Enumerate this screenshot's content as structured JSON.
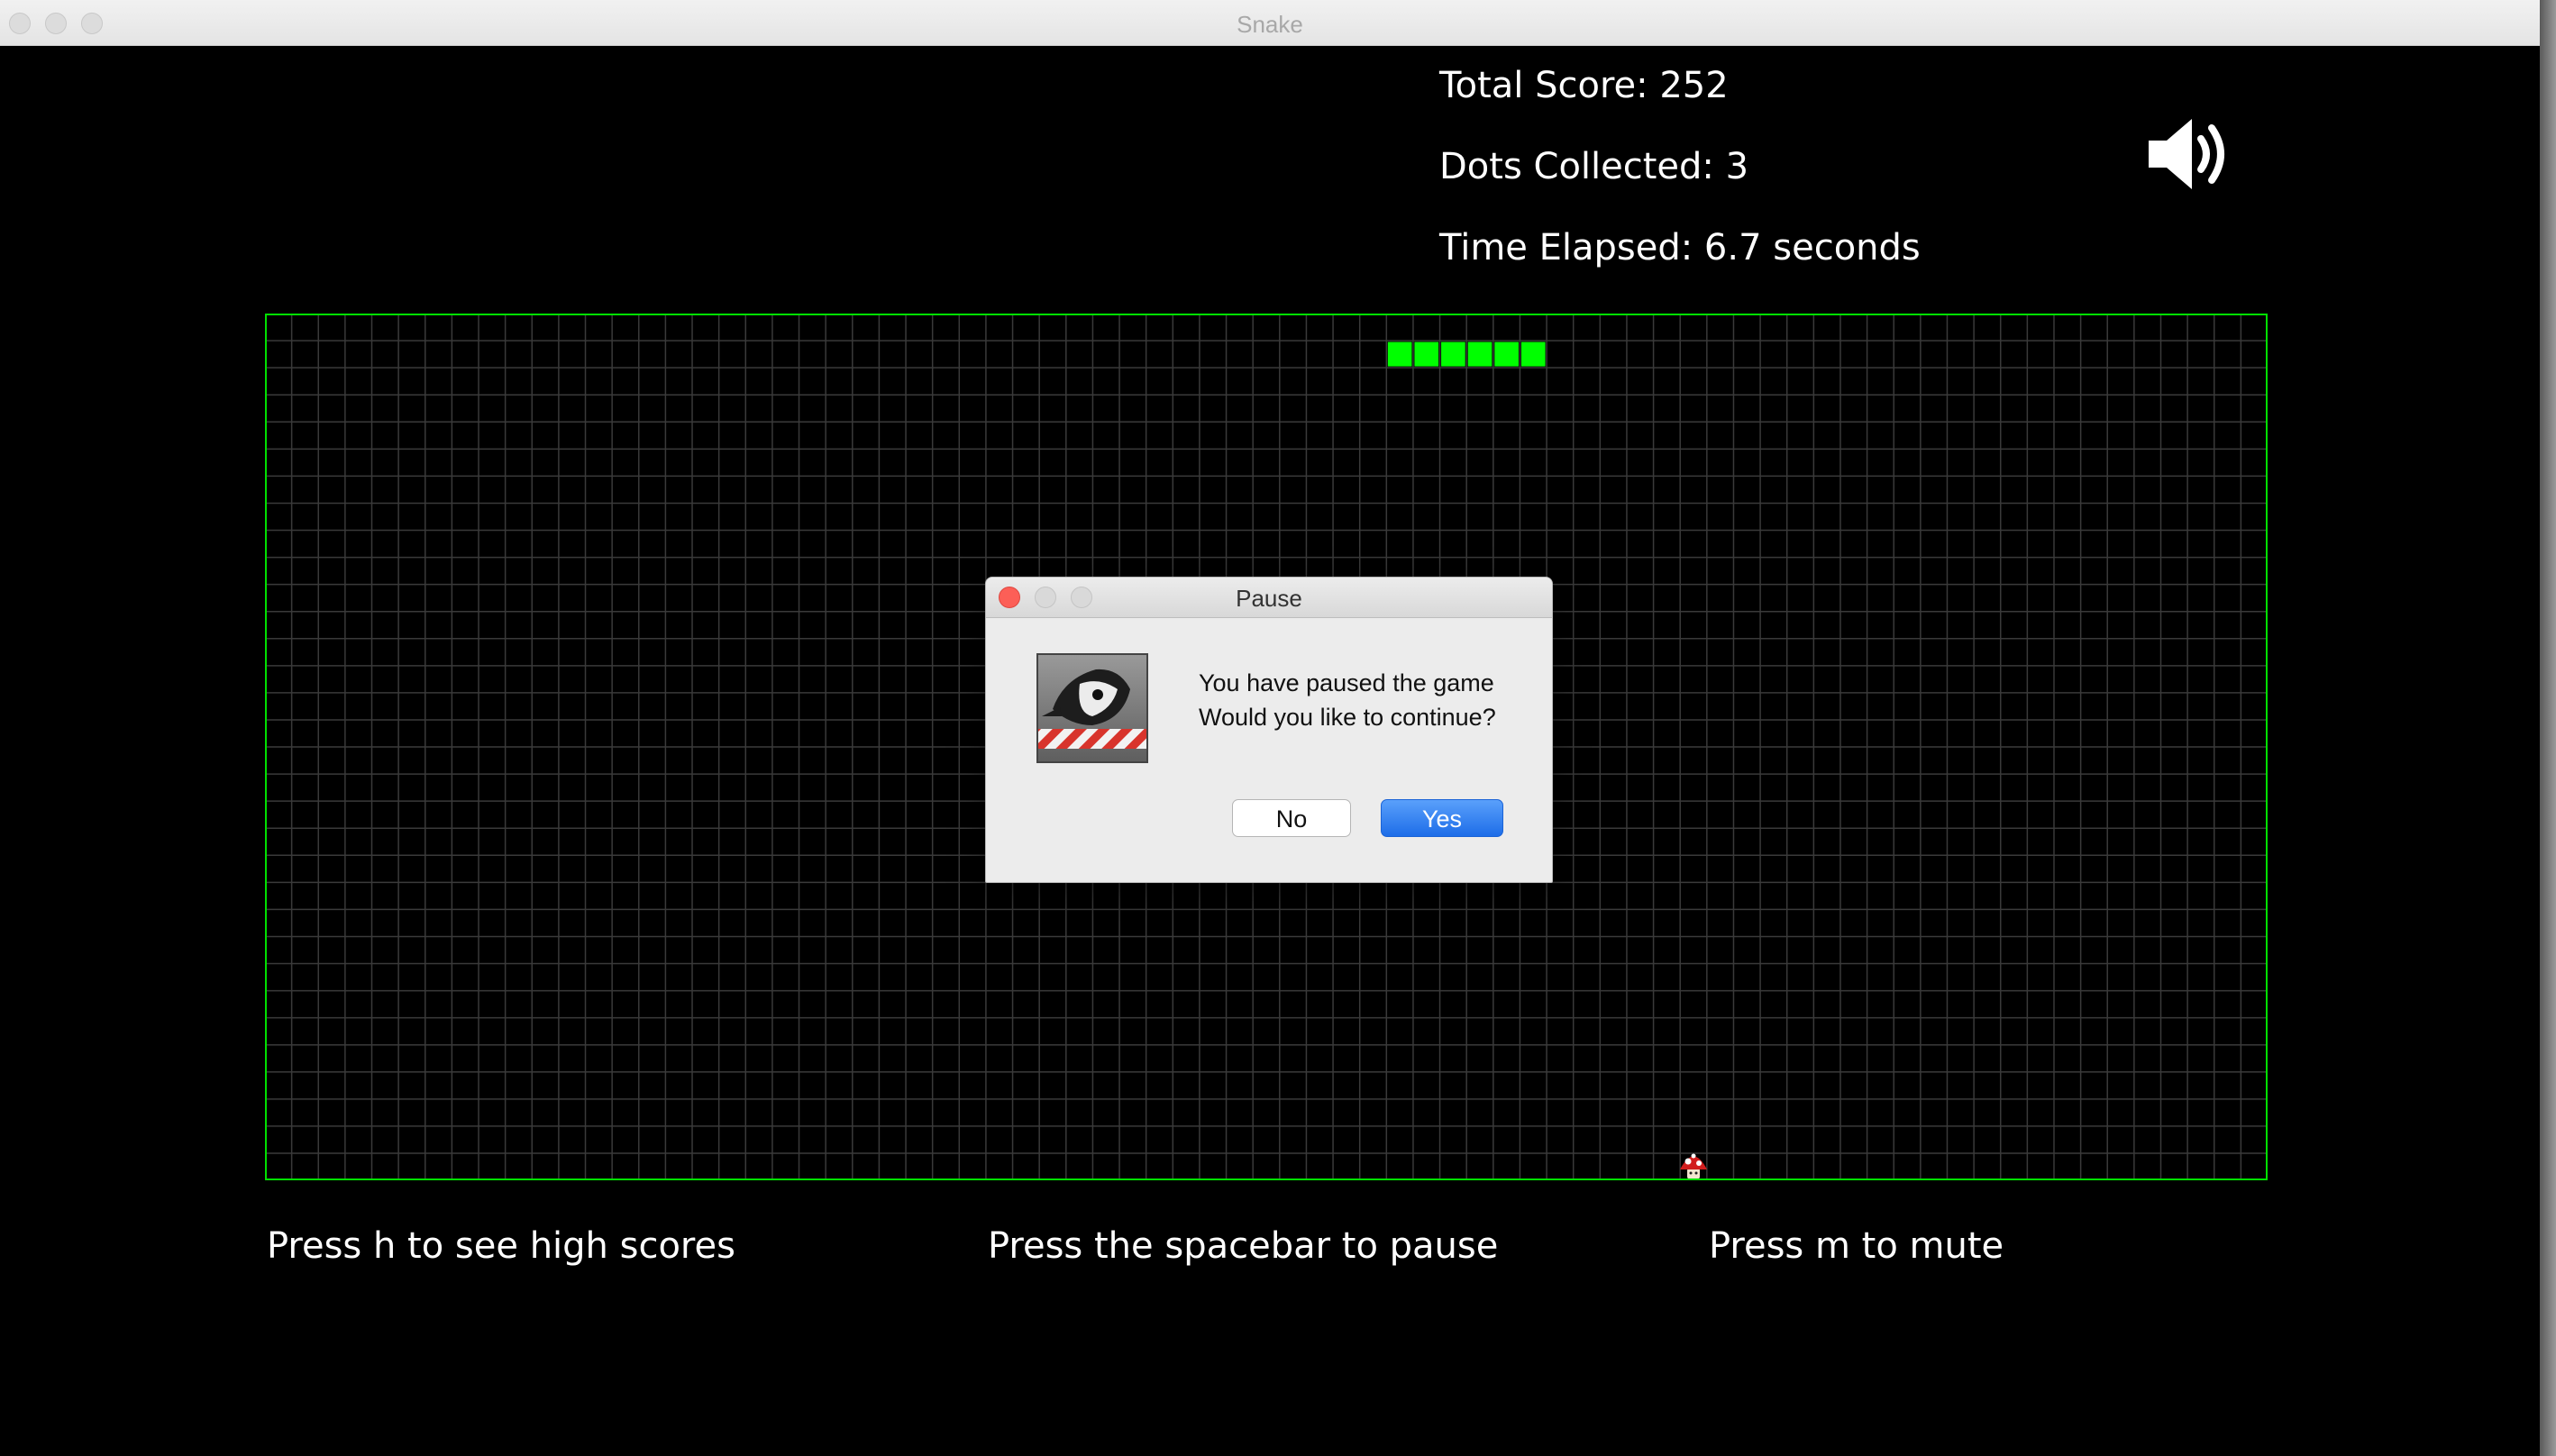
{
  "window": {
    "title": "Snake"
  },
  "stats": {
    "total_score": "Total Score: 252",
    "dots_collected": "Dots Collected: 3",
    "time_elapsed": "Time Elapsed: 6.7 seconds"
  },
  "sound": {
    "icon": "speaker-on-icon",
    "state": "unmuted"
  },
  "board": {
    "columns": 75,
    "rows": 32,
    "border_color": "#00e000",
    "grid_color": "#3a3a3a",
    "snake_color": "#00ff00",
    "snake": [
      [
        42,
        1
      ],
      [
        43,
        1
      ],
      [
        44,
        1
      ],
      [
        45,
        1
      ],
      [
        46,
        1
      ],
      [
        47,
        1
      ]
    ],
    "food": {
      "col": 53,
      "row": 31,
      "icon": "mushroom-icon"
    }
  },
  "hints": {
    "high_scores": "Press h to see high scores",
    "pause": "Press the spacebar to pause",
    "mute": "Press m to mute"
  },
  "dialog": {
    "title": "Pause",
    "icon": "java-duke-icon",
    "line1": "You have paused the game",
    "line2": "Would you like to continue?",
    "no_label": "No",
    "yes_label": "Yes"
  }
}
